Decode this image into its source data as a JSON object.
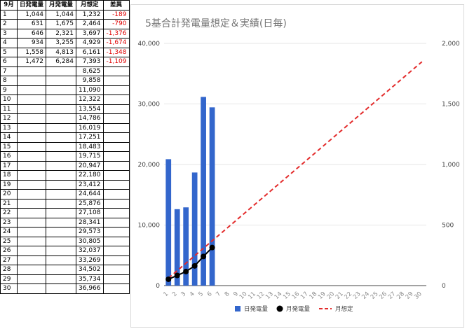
{
  "table": {
    "headers": [
      "9月",
      "日発電量",
      "月発電量",
      "月想定",
      "差異"
    ],
    "rows": [
      {
        "day": "1",
        "daily": "1,044",
        "monthly": "1,044",
        "target": "1,232",
        "diff": "-189"
      },
      {
        "day": "2",
        "daily": "631",
        "monthly": "1,675",
        "target": "2,464",
        "diff": "-790"
      },
      {
        "day": "3",
        "daily": "646",
        "monthly": "2,321",
        "target": "3,697",
        "diff": "-1,376"
      },
      {
        "day": "4",
        "daily": "934",
        "monthly": "3,255",
        "target": "4,929",
        "diff": "-1,674"
      },
      {
        "day": "5",
        "daily": "1,558",
        "monthly": "4,813",
        "target": "6,161",
        "diff": "-1,348"
      },
      {
        "day": "6",
        "daily": "1,472",
        "monthly": "6,284",
        "target": "7,393",
        "diff": "-1,109"
      },
      {
        "day": "7",
        "daily": "",
        "monthly": "",
        "target": "8,625",
        "diff": ""
      },
      {
        "day": "8",
        "daily": "",
        "monthly": "",
        "target": "9,858",
        "diff": ""
      },
      {
        "day": "9",
        "daily": "",
        "monthly": "",
        "target": "11,090",
        "diff": ""
      },
      {
        "day": "10",
        "daily": "",
        "monthly": "",
        "target": "12,322",
        "diff": ""
      },
      {
        "day": "11",
        "daily": "",
        "monthly": "",
        "target": "13,554",
        "diff": ""
      },
      {
        "day": "12",
        "daily": "",
        "monthly": "",
        "target": "14,786",
        "diff": ""
      },
      {
        "day": "13",
        "daily": "",
        "monthly": "",
        "target": "16,019",
        "diff": ""
      },
      {
        "day": "14",
        "daily": "",
        "monthly": "",
        "target": "17,251",
        "diff": ""
      },
      {
        "day": "15",
        "daily": "",
        "monthly": "",
        "target": "18,483",
        "diff": ""
      },
      {
        "day": "16",
        "daily": "",
        "monthly": "",
        "target": "19,715",
        "diff": ""
      },
      {
        "day": "17",
        "daily": "",
        "monthly": "",
        "target": "20,947",
        "diff": ""
      },
      {
        "day": "18",
        "daily": "",
        "monthly": "",
        "target": "22,180",
        "diff": ""
      },
      {
        "day": "19",
        "daily": "",
        "monthly": "",
        "target": "23,412",
        "diff": ""
      },
      {
        "day": "20",
        "daily": "",
        "monthly": "",
        "target": "24,644",
        "diff": ""
      },
      {
        "day": "21",
        "daily": "",
        "monthly": "",
        "target": "25,876",
        "diff": ""
      },
      {
        "day": "22",
        "daily": "",
        "monthly": "",
        "target": "27,108",
        "diff": ""
      },
      {
        "day": "23",
        "daily": "",
        "monthly": "",
        "target": "28,341",
        "diff": ""
      },
      {
        "day": "24",
        "daily": "",
        "monthly": "",
        "target": "29,573",
        "diff": ""
      },
      {
        "day": "25",
        "daily": "",
        "monthly": "",
        "target": "30,805",
        "diff": ""
      },
      {
        "day": "26",
        "daily": "",
        "monthly": "",
        "target": "32,037",
        "diff": ""
      },
      {
        "day": "27",
        "daily": "",
        "monthly": "",
        "target": "33,269",
        "diff": ""
      },
      {
        "day": "28",
        "daily": "",
        "monthly": "",
        "target": "34,502",
        "diff": ""
      },
      {
        "day": "29",
        "daily": "",
        "monthly": "",
        "target": "35,734",
        "diff": ""
      },
      {
        "day": "30",
        "daily": "",
        "monthly": "",
        "target": "36,966",
        "diff": ""
      }
    ]
  },
  "chart_data": {
    "type": "bar",
    "title": "5基合計発電量想定＆実績(日毎)",
    "title_color": "#757575",
    "categories": [
      "1",
      "2",
      "3",
      "4",
      "5",
      "6",
      "7",
      "8",
      "9",
      "10",
      "11",
      "12",
      "13",
      "14",
      "15",
      "16",
      "17",
      "18",
      "19",
      "20",
      "21",
      "22",
      "23",
      "24",
      "25",
      "26",
      "27",
      "28",
      "29",
      "30"
    ],
    "y_left": {
      "ticks": [
        "0",
        "10,000",
        "20,000",
        "30,000",
        "40,000"
      ],
      "ylim": [
        0,
        40000
      ]
    },
    "y_right": {
      "ticks": [
        "0",
        "500",
        "1,000",
        "1,500",
        "2,000"
      ],
      "ylim": [
        0,
        2000
      ]
    },
    "grid": true,
    "legend_position": "bottom",
    "series": [
      {
        "name": "日発電量",
        "kind": "bar",
        "axis": "right",
        "color": "#3366cc",
        "values": [
          1044,
          631,
          646,
          934,
          1558,
          1472
        ]
      },
      {
        "name": "月発電量",
        "kind": "line-markers",
        "axis": "left",
        "color": "#000000",
        "values": [
          1044,
          1675,
          2321,
          3255,
          4813,
          6284
        ]
      },
      {
        "name": "月想定",
        "kind": "dashed-line",
        "axis": "left",
        "color": "#e32b2b",
        "values": [
          1232,
          2464,
          3697,
          4929,
          6161,
          7393,
          8625,
          9858,
          11090,
          12322,
          13554,
          14786,
          16019,
          17251,
          18483,
          19715,
          20947,
          22180,
          23412,
          24644,
          25876,
          27108,
          28341,
          29573,
          30805,
          32037,
          33269,
          34502,
          35734,
          36966
        ]
      }
    ]
  }
}
